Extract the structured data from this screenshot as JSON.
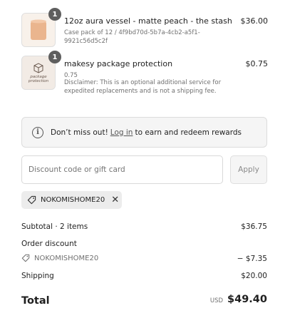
{
  "items": [
    {
      "quantity": "1",
      "name": "12oz aura vessel - matte peach - the stash",
      "meta": "Case pack of 12 / 4f9bd70d-5b7a-4cb2-a5f1-9921c56d5c2f",
      "price": "$36.00",
      "thumb_icon": "candle-vessel-image"
    },
    {
      "quantity": "1",
      "name": "makesy package protection",
      "meta_price": "0.75",
      "meta": "Disclaimer: This is an optional additional service for expedited replacements and is not a shipping fee.",
      "price": "$0.75",
      "thumb_icon": "package-protection-image",
      "thumb_text": "package protection"
    }
  ],
  "rewards": {
    "prefix": "Don’t miss out!",
    "link": "Log in",
    "suffix": "to earn and redeem rewards"
  },
  "discount": {
    "placeholder": "Discount code or gift card",
    "apply_label": "Apply",
    "applied_code": "NOKOMISHOME20"
  },
  "summary": {
    "subtotal_label": "Subtotal · 2 items",
    "subtotal_value": "$36.75",
    "order_discount_label": "Order discount",
    "discount_code": "NOKOMISHOME20",
    "discount_value": "− $7.35",
    "shipping_label": "Shipping",
    "shipping_value": "$20.00",
    "total_label": "Total",
    "currency": "USD",
    "total_value": "$49.40"
  },
  "colors": {
    "badge": "#5e5e5e",
    "thumb_peach": "#e9b58f",
    "panel_bg": "#f5f5f5"
  }
}
